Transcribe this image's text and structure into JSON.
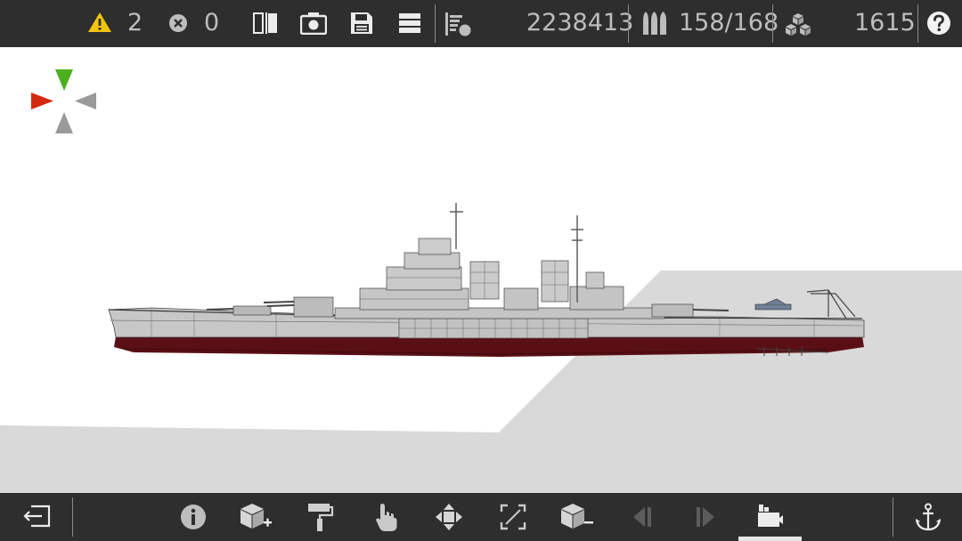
{
  "topbar": {
    "warnings_count": "2",
    "errors_count": "0",
    "cost": "2238413",
    "ammo": "158/168",
    "parts_count": "1615",
    "icons": [
      "warning-icon",
      "error-icon",
      "mirror-icon",
      "screenshot-icon",
      "save-icon",
      "menu-icon",
      "stats-icon",
      "ammo-icon",
      "parts-icon",
      "help-icon"
    ]
  },
  "bottombar": {
    "icons": [
      "exit-icon",
      "info-icon",
      "add-part-icon",
      "paint-icon",
      "select-icon",
      "move-icon",
      "rotate-icon",
      "remove-part-icon",
      "prev-icon",
      "next-icon",
      "shipyard-icon",
      "anchor-icon"
    ],
    "active": "shipyard-icon"
  },
  "viewport": {
    "axis_colors": {
      "up": "#4caf1e",
      "left": "#d42a10",
      "neutral": "#9a9a9a"
    },
    "warning_color": "#f2c40f",
    "hull_color": "#c7c7c7",
    "waterline_color": "#5a0f14"
  }
}
